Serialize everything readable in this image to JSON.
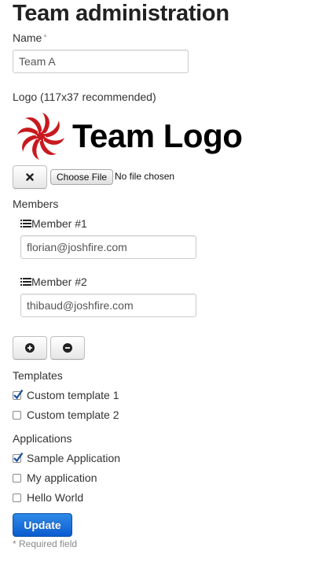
{
  "page": {
    "title": "Team administration"
  },
  "name_field": {
    "label": "Name",
    "required_marker": "*",
    "value": "Team A"
  },
  "logo": {
    "label": "Logo (117x37 recommended)",
    "image_text": "Team Logo",
    "clear_icon": "close-icon",
    "choose_file_label": "Choose File",
    "file_status": "No file chosen",
    "colors": {
      "swirl": "#c8191e",
      "text": "#000000"
    }
  },
  "members": {
    "label": "Members",
    "items": [
      {
        "label": "Member #1",
        "icon": "list-icon",
        "value": "florian@joshfire.com"
      },
      {
        "label": "Member #2",
        "icon": "list-icon",
        "value": "thibaud@joshfire.com"
      }
    ],
    "add_icon": "plus-circle-icon",
    "remove_icon": "minus-circle-icon"
  },
  "templates": {
    "label": "Templates",
    "items": [
      {
        "label": "Custom template 1",
        "checked": true
      },
      {
        "label": "Custom template 2",
        "checked": false
      }
    ]
  },
  "applications": {
    "label": "Applications",
    "items": [
      {
        "label": "Sample Application",
        "checked": true
      },
      {
        "label": "My application",
        "checked": false
      },
      {
        "label": "Hello World",
        "checked": false
      }
    ]
  },
  "actions": {
    "update_label": "Update",
    "accent": "#0b5ccf"
  },
  "footer": {
    "required_note": "* Required field"
  }
}
